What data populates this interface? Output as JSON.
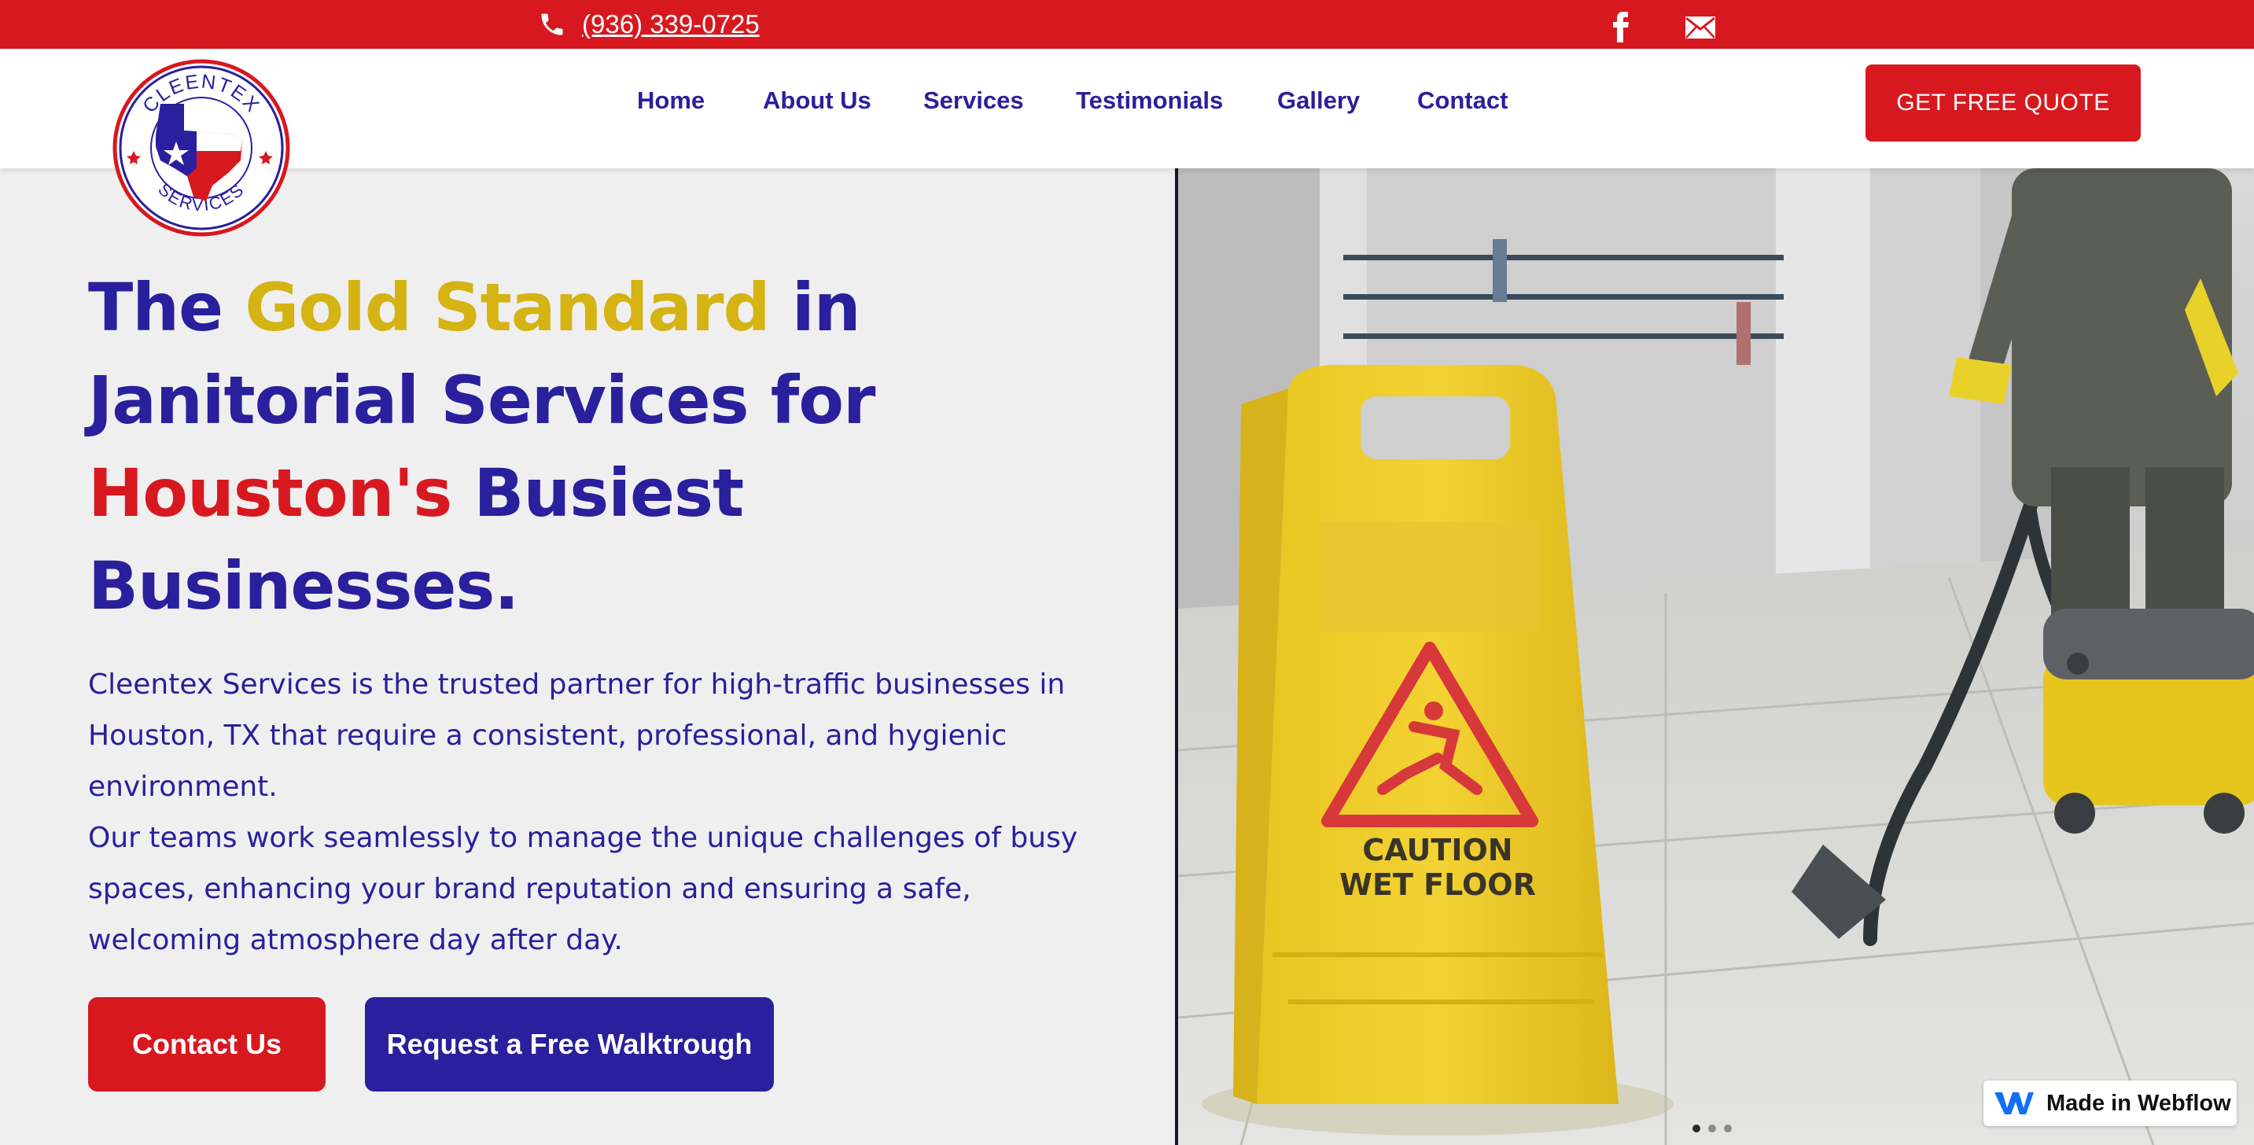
{
  "topbar": {
    "phone": "(936) 339-0725",
    "icons": [
      "phone-icon",
      "facebook-icon",
      "mail-icon"
    ],
    "color": "#d7191f"
  },
  "logo": {
    "top_text": "CLEENTEX",
    "bottom_text": "SERVICES"
  },
  "nav": {
    "items": [
      {
        "label": "Home"
      },
      {
        "label": "About Us"
      },
      {
        "label": "Services"
      },
      {
        "label": "Testimonials"
      },
      {
        "label": "Gallery"
      },
      {
        "label": "Contact"
      }
    ],
    "cta": "GET FREE QUOTE"
  },
  "hero": {
    "title_part1": "The ",
    "title_gold": "Gold Standard",
    "title_part2": " in Janitorial Services for ",
    "title_red": "Houston's",
    "title_part3": " Busiest Businesses.",
    "paragraph1": "Cleentex Services is the trusted partner for high-traffic businesses in Houston, TX that require a consistent, professional, and hygienic environment.",
    "paragraph2": "Our teams work seamlessly to manage the unique challenges of busy spaces, enhancing your brand reputation and ensuring a safe, welcoming atmosphere day after day.",
    "btn_contact": "Contact Us",
    "btn_walkthrough": "Request a Free Walktrough"
  },
  "image": {
    "sign_line1": "CAUTION",
    "sign_line2": "WET FLOOR"
  },
  "slider": {
    "total": 3,
    "active": 1
  },
  "badge": {
    "label": "Made in Webflow"
  },
  "colors": {
    "brand_blue": "#2a1f9c",
    "brand_red": "#d7191f",
    "brand_gold": "#d4b312"
  }
}
